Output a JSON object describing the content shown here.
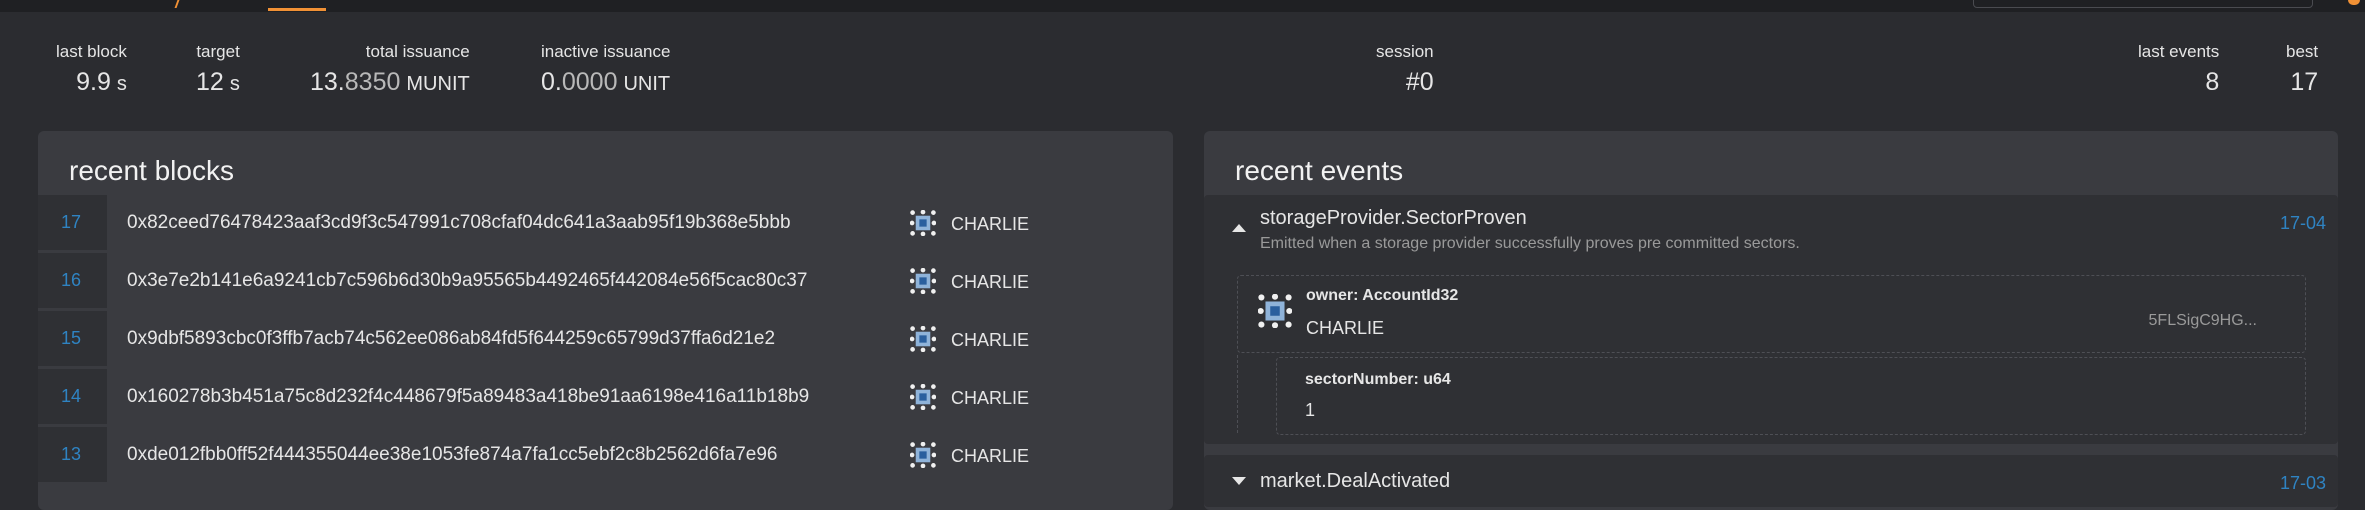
{
  "summary": {
    "last_block": {
      "label": "last block",
      "value": "9.9",
      "unit": "s"
    },
    "target": {
      "label": "target",
      "value": "12",
      "unit": "s"
    },
    "total_issuance": {
      "label": "total issuance",
      "value_int": "13.",
      "value_dec": "8350",
      "unit": "MUNIT"
    },
    "inactive_issuance": {
      "label": "inactive issuance",
      "value_int": "0.",
      "value_dec": "0000",
      "unit": "UNIT"
    },
    "session": {
      "label": "session",
      "value": "#0"
    },
    "last_events": {
      "label": "last events",
      "value": "8"
    },
    "best": {
      "label": "best",
      "value": "17"
    }
  },
  "recent_blocks": {
    "title": "recent blocks",
    "rows": [
      {
        "number": "17",
        "hash": "0x82ceed76478423aaf3cd9f3c547991c708cfaf04dc641a3aab95f19b368e5bbb",
        "author": "CHARLIE"
      },
      {
        "number": "16",
        "hash": "0x3e7e2b141e6a9241cb7c596b6d30b9a95565b4492465f442084e56f5cac80c37",
        "author": "CHARLIE"
      },
      {
        "number": "15",
        "hash": "0x9dbf5893cbc0f3ffb7acb74c562ee086ab84fd5f644259c65799d37ffa6d21e2",
        "author": "CHARLIE"
      },
      {
        "number": "14",
        "hash": "0x160278b3b451a75c8d232f4c448679f5a89483a418be91aa6198e416a11b18b9",
        "author": "CHARLIE"
      },
      {
        "number": "13",
        "hash": "0xde012fbb0ff52f444355044ee38e1053fe874a7fa1cc5ebf2c8b2562d6fa7e96",
        "author": "CHARLIE"
      }
    ]
  },
  "recent_events": {
    "title": "recent events",
    "events": [
      {
        "name": "storageProvider.SectorProven",
        "description": "Emitted when a storage provider successfully proves pre committed sectors.",
        "when": "17-04",
        "params": [
          {
            "name": "owner: AccountId32",
            "value": "CHARLIE",
            "address": "5FLSigC9HG..."
          },
          {
            "name": "sectorNumber: u64",
            "value": "1"
          }
        ]
      },
      {
        "name": "market.DealActivated",
        "when": "17-03"
      }
    ]
  },
  "colors": {
    "accent": "#f19135",
    "link": "#2f83c2",
    "panel": "#3a3b40",
    "row": "#2f3034",
    "background": "#2b2c30"
  },
  "icons": {
    "author_identicon": "identicon-icon",
    "expand": "caret-up-icon",
    "collapsed": "caret-down-icon"
  }
}
